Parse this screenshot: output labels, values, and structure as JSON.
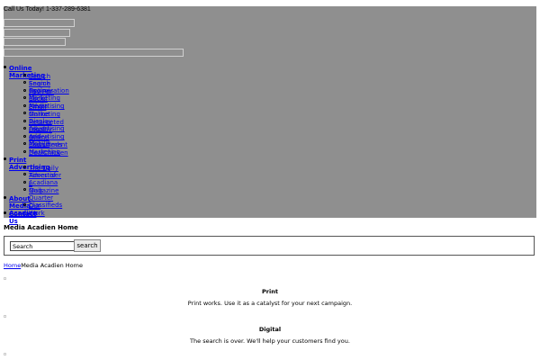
{
  "header": {
    "call_text": "Call Us Today! 1-337-289-6381"
  },
  "nav": [
    {
      "label": "Online Marketing",
      "children": [
        "Search Engine Optimization",
        "Search Engine Marketing",
        "Pay-Per-Click Advertising",
        "Social Media",
        "Email Marketing",
        "Online Display Advertising",
        "Retargeted Display Advertising",
        "Local and Mobile",
        "Online Classifieds",
        "Recruitment Marketing",
        "DealChicken"
      ]
    },
    {
      "label": "Print Advertising",
      "children": [
        "The Daily Advertiser",
        "Times of Acadiana",
        "L Magazine",
        "Quik Quarter Classifieds"
      ]
    },
    {
      "label": "About Media Acadien",
      "children": [
        "Our Work"
      ]
    },
    {
      "label": "Contact Us",
      "children": []
    }
  ],
  "page_title": "Media Acadien Home",
  "search": {
    "value": "Search",
    "button": "search"
  },
  "breadcrumb": {
    "home": "Home",
    "current": "Media Acadien Home"
  },
  "sections": [
    {
      "title": "Print",
      "text": "Print works.  Use it as a catalyst for your next campaign."
    },
    {
      "title": "Digital",
      "text": "The search is over. We'll help your customers find you."
    }
  ]
}
